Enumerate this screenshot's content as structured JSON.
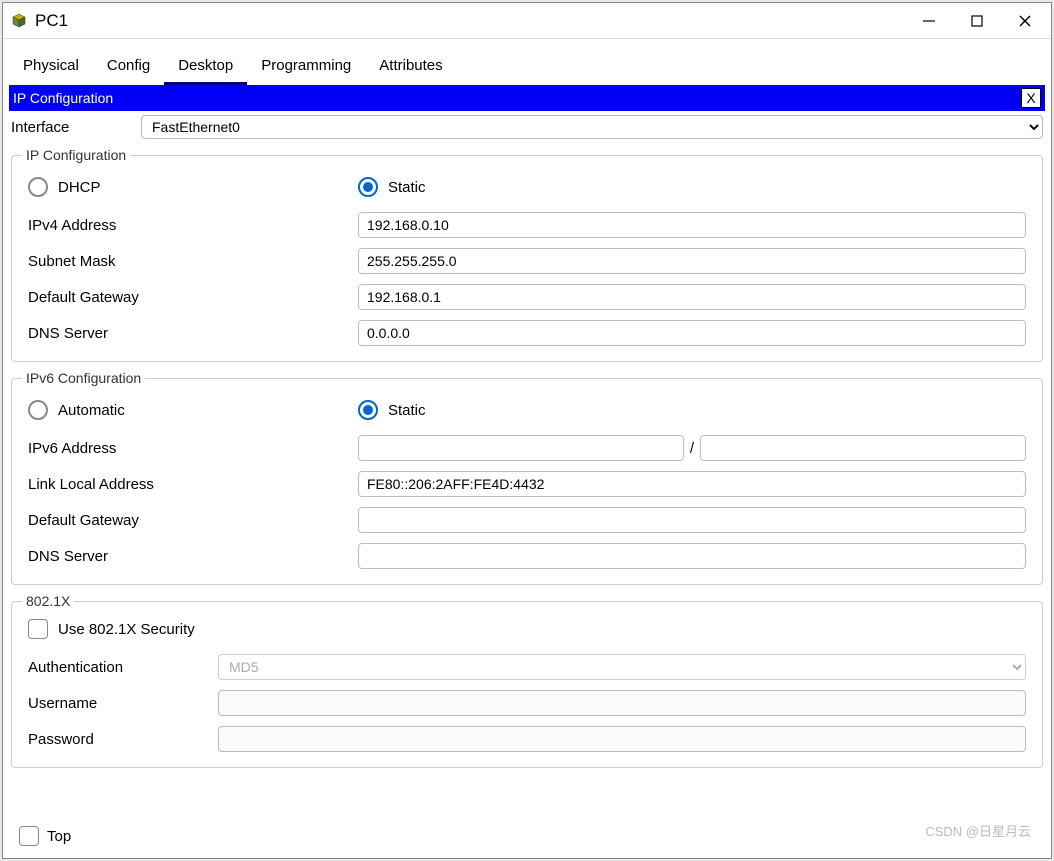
{
  "window": {
    "title": "PC1"
  },
  "tabs": {
    "physical": "Physical",
    "config": "Config",
    "desktop": "Desktop",
    "programming": "Programming",
    "attributes": "Attributes"
  },
  "panel": {
    "title": "IP Configuration",
    "close": "X"
  },
  "interface": {
    "label": "Interface",
    "value": "FastEthernet0"
  },
  "ipconfig": {
    "legend": "IP Configuration",
    "dhcp": "DHCP",
    "static": "Static",
    "ipv4_label": "IPv4 Address",
    "ipv4_value": "192.168.0.10",
    "subnet_label": "Subnet Mask",
    "subnet_value": "255.255.255.0",
    "gateway_label": "Default Gateway",
    "gateway_value": "192.168.0.1",
    "dns_label": "DNS Server",
    "dns_value": "0.0.0.0"
  },
  "ipv6config": {
    "legend": "IPv6 Configuration",
    "automatic": "Automatic",
    "static": "Static",
    "ipv6_label": "IPv6 Address",
    "ipv6_value": "",
    "prefix_value": "",
    "slash": "/",
    "linklocal_label": "Link Local Address",
    "linklocal_value": "FE80::206:2AFF:FE4D:4432",
    "gateway_label": "Default Gateway",
    "gateway_value": "",
    "dns_label": "DNS Server",
    "dns_value": ""
  },
  "dot1x": {
    "legend": "802.1X",
    "use_security": "Use 802.1X Security",
    "auth_label": "Authentication",
    "auth_value": "MD5",
    "user_label": "Username",
    "user_value": "",
    "pass_label": "Password",
    "pass_value": ""
  },
  "footer": {
    "top": "Top"
  },
  "watermark": "CSDN @日星月云"
}
